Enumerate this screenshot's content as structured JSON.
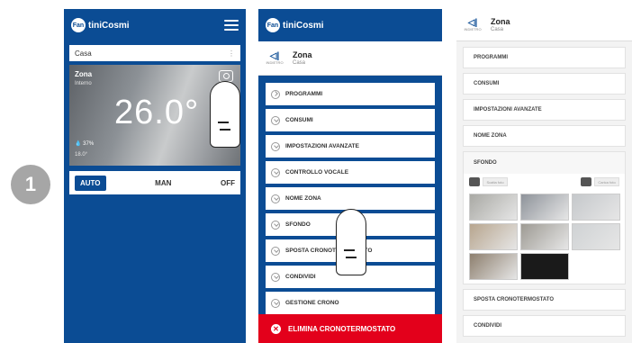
{
  "step": "1",
  "phone1": {
    "brand": "FantiniCosmi",
    "brand_short": "Fan",
    "brand_rest": "tiniCosmi",
    "home_select": "Casa",
    "zone": {
      "name": "Zona",
      "subtitle": "Interno",
      "temperature": "26.0°",
      "humidity": "37%",
      "outdoor": "18.0°"
    },
    "modes": [
      "AUTO",
      "MAN",
      "OFF"
    ],
    "active_mode": "AUTO"
  },
  "phone2": {
    "brand_short": "Fan",
    "brand_rest": "tiniCosmi",
    "header": {
      "title": "Zona",
      "subtitle": "Casa",
      "back_label": "INDIETRO"
    },
    "menu": [
      "PROGRAMMI",
      "CONSUMI",
      "IMPOSTAZIONI AVANZATE",
      "CONTROLLO VOCALE",
      "NOME ZONA",
      "SFONDO",
      "SPOSTA CRONOTERMOSTATO",
      "CONDIVIDI",
      "GESTIONE CRONO"
    ],
    "delete_label": "ELIMINA CRONOTERMOSTATO"
  },
  "phone3": {
    "header": {
      "title": "Zona",
      "subtitle": "Casa",
      "back_label": "INDIETRO"
    },
    "menu_top": [
      "PROGRAMMI",
      "CONSUMI",
      "IMPOSTAZIONI AVANZATE",
      "NOME ZONA"
    ],
    "background": {
      "label": "SFONDO",
      "camera_label": "Scatta foto",
      "upload_label": "Carica foto",
      "thumb_colors": [
        "#a9a9a4",
        "#8e939a",
        "#c5c8cb",
        "#b7a58e",
        "#9d9a93",
        "#cfd2d4",
        "#8d7f6e",
        "#1a1a1a"
      ]
    },
    "menu_bottom": [
      "SPOSTA CRONOTERMOSTATO",
      "CONDIVIDI"
    ]
  },
  "colors": {
    "brand_blue": "#0b4c94",
    "danger_red": "#e3001b",
    "step_gray": "#a6a6a6"
  }
}
